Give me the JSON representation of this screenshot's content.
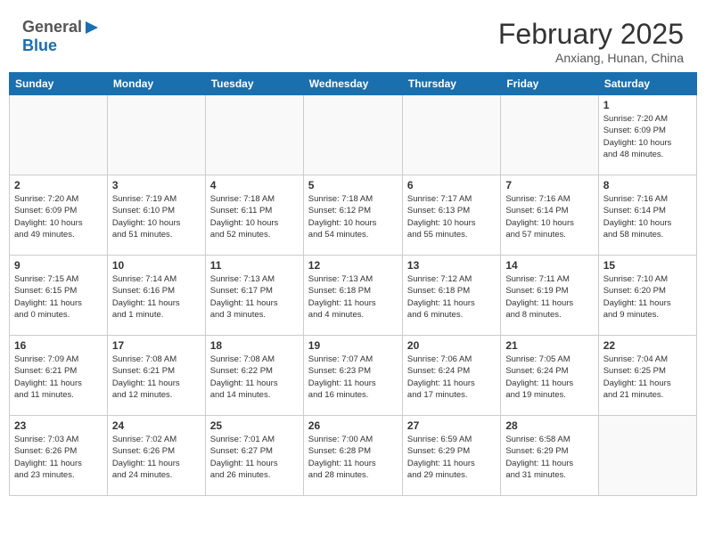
{
  "header": {
    "logo_general": "General",
    "logo_blue": "Blue",
    "month_title": "February 2025",
    "location": "Anxiang, Hunan, China"
  },
  "weekdays": [
    "Sunday",
    "Monday",
    "Tuesday",
    "Wednesday",
    "Thursday",
    "Friday",
    "Saturday"
  ],
  "weeks": [
    [
      {
        "day": "",
        "info": ""
      },
      {
        "day": "",
        "info": ""
      },
      {
        "day": "",
        "info": ""
      },
      {
        "day": "",
        "info": ""
      },
      {
        "day": "",
        "info": ""
      },
      {
        "day": "",
        "info": ""
      },
      {
        "day": "1",
        "info": "Sunrise: 7:20 AM\nSunset: 6:09 PM\nDaylight: 10 hours\nand 48 minutes."
      }
    ],
    [
      {
        "day": "2",
        "info": "Sunrise: 7:20 AM\nSunset: 6:09 PM\nDaylight: 10 hours\nand 49 minutes."
      },
      {
        "day": "3",
        "info": "Sunrise: 7:19 AM\nSunset: 6:10 PM\nDaylight: 10 hours\nand 51 minutes."
      },
      {
        "day": "4",
        "info": "Sunrise: 7:18 AM\nSunset: 6:11 PM\nDaylight: 10 hours\nand 52 minutes."
      },
      {
        "day": "5",
        "info": "Sunrise: 7:18 AM\nSunset: 6:12 PM\nDaylight: 10 hours\nand 54 minutes."
      },
      {
        "day": "6",
        "info": "Sunrise: 7:17 AM\nSunset: 6:13 PM\nDaylight: 10 hours\nand 55 minutes."
      },
      {
        "day": "7",
        "info": "Sunrise: 7:16 AM\nSunset: 6:14 PM\nDaylight: 10 hours\nand 57 minutes."
      },
      {
        "day": "8",
        "info": "Sunrise: 7:16 AM\nSunset: 6:14 PM\nDaylight: 10 hours\nand 58 minutes."
      }
    ],
    [
      {
        "day": "9",
        "info": "Sunrise: 7:15 AM\nSunset: 6:15 PM\nDaylight: 11 hours\nand 0 minutes."
      },
      {
        "day": "10",
        "info": "Sunrise: 7:14 AM\nSunset: 6:16 PM\nDaylight: 11 hours\nand 1 minute."
      },
      {
        "day": "11",
        "info": "Sunrise: 7:13 AM\nSunset: 6:17 PM\nDaylight: 11 hours\nand 3 minutes."
      },
      {
        "day": "12",
        "info": "Sunrise: 7:13 AM\nSunset: 6:18 PM\nDaylight: 11 hours\nand 4 minutes."
      },
      {
        "day": "13",
        "info": "Sunrise: 7:12 AM\nSunset: 6:18 PM\nDaylight: 11 hours\nand 6 minutes."
      },
      {
        "day": "14",
        "info": "Sunrise: 7:11 AM\nSunset: 6:19 PM\nDaylight: 11 hours\nand 8 minutes."
      },
      {
        "day": "15",
        "info": "Sunrise: 7:10 AM\nSunset: 6:20 PM\nDaylight: 11 hours\nand 9 minutes."
      }
    ],
    [
      {
        "day": "16",
        "info": "Sunrise: 7:09 AM\nSunset: 6:21 PM\nDaylight: 11 hours\nand 11 minutes."
      },
      {
        "day": "17",
        "info": "Sunrise: 7:08 AM\nSunset: 6:21 PM\nDaylight: 11 hours\nand 12 minutes."
      },
      {
        "day": "18",
        "info": "Sunrise: 7:08 AM\nSunset: 6:22 PM\nDaylight: 11 hours\nand 14 minutes."
      },
      {
        "day": "19",
        "info": "Sunrise: 7:07 AM\nSunset: 6:23 PM\nDaylight: 11 hours\nand 16 minutes."
      },
      {
        "day": "20",
        "info": "Sunrise: 7:06 AM\nSunset: 6:24 PM\nDaylight: 11 hours\nand 17 minutes."
      },
      {
        "day": "21",
        "info": "Sunrise: 7:05 AM\nSunset: 6:24 PM\nDaylight: 11 hours\nand 19 minutes."
      },
      {
        "day": "22",
        "info": "Sunrise: 7:04 AM\nSunset: 6:25 PM\nDaylight: 11 hours\nand 21 minutes."
      }
    ],
    [
      {
        "day": "23",
        "info": "Sunrise: 7:03 AM\nSunset: 6:26 PM\nDaylight: 11 hours\nand 23 minutes."
      },
      {
        "day": "24",
        "info": "Sunrise: 7:02 AM\nSunset: 6:26 PM\nDaylight: 11 hours\nand 24 minutes."
      },
      {
        "day": "25",
        "info": "Sunrise: 7:01 AM\nSunset: 6:27 PM\nDaylight: 11 hours\nand 26 minutes."
      },
      {
        "day": "26",
        "info": "Sunrise: 7:00 AM\nSunset: 6:28 PM\nDaylight: 11 hours\nand 28 minutes."
      },
      {
        "day": "27",
        "info": "Sunrise: 6:59 AM\nSunset: 6:29 PM\nDaylight: 11 hours\nand 29 minutes."
      },
      {
        "day": "28",
        "info": "Sunrise: 6:58 AM\nSunset: 6:29 PM\nDaylight: 11 hours\nand 31 minutes."
      },
      {
        "day": "",
        "info": ""
      }
    ]
  ]
}
